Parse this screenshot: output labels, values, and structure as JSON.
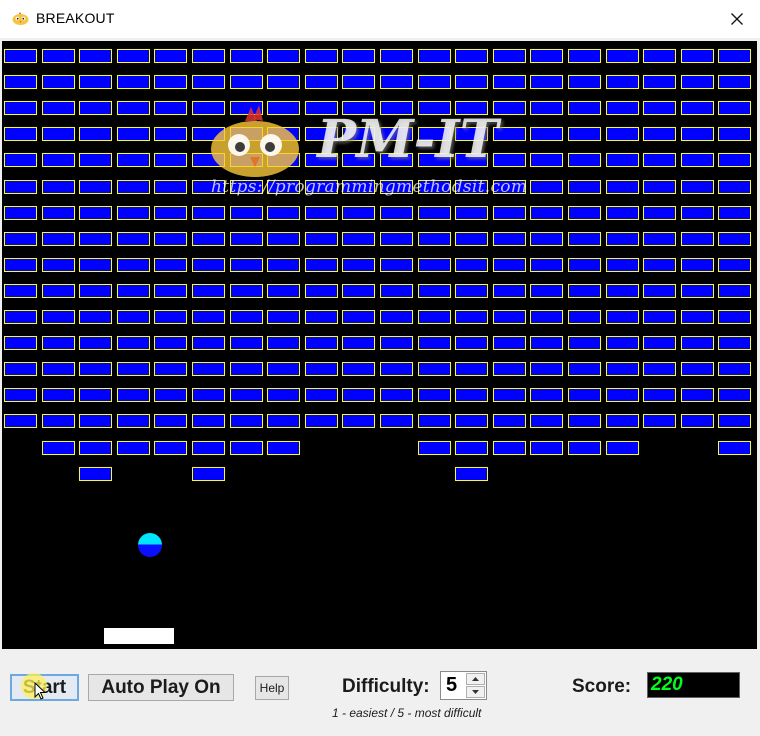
{
  "window": {
    "title": "BREAKOUT",
    "app_icon": "chick-icon",
    "close_icon": "close-icon"
  },
  "watermark": {
    "brand": "PM-IT",
    "url": "https://programmingmethodsit.com",
    "mascot": "chick-mascot"
  },
  "bricks": {
    "colors": {
      "fill": "#0000ff",
      "border": "#ffff00"
    },
    "rows": [
      "11111111111111111111",
      "11111111111111111111",
      "11111111111111111111",
      "11111111111111111111",
      "11111111111111111111",
      "11111111111111111111",
      "11111111111111111111",
      "11111111111111111111",
      "11111111111111111111",
      "11111111111111111111",
      "11111111111111111111",
      "11111111111111111111",
      "11111111111111111111",
      "11111111111111111111",
      "11111111111111111111",
      "01111111000111111001",
      "00100100000010000000"
    ]
  },
  "ball": {
    "colors": [
      "#00e5ff",
      "#0a10ff"
    ]
  },
  "paddle": {
    "color": "#ffffff"
  },
  "controls": {
    "start_label": "Start",
    "autoplay_label": "Auto Play On",
    "help_label": "Help",
    "difficulty_label": "Difficulty:",
    "difficulty_value": "5",
    "difficulty_hint": "1 - easiest / 5 - most difficult",
    "score_label": "Score:",
    "score_value": "220",
    "score_color": "#00ff1a"
  }
}
